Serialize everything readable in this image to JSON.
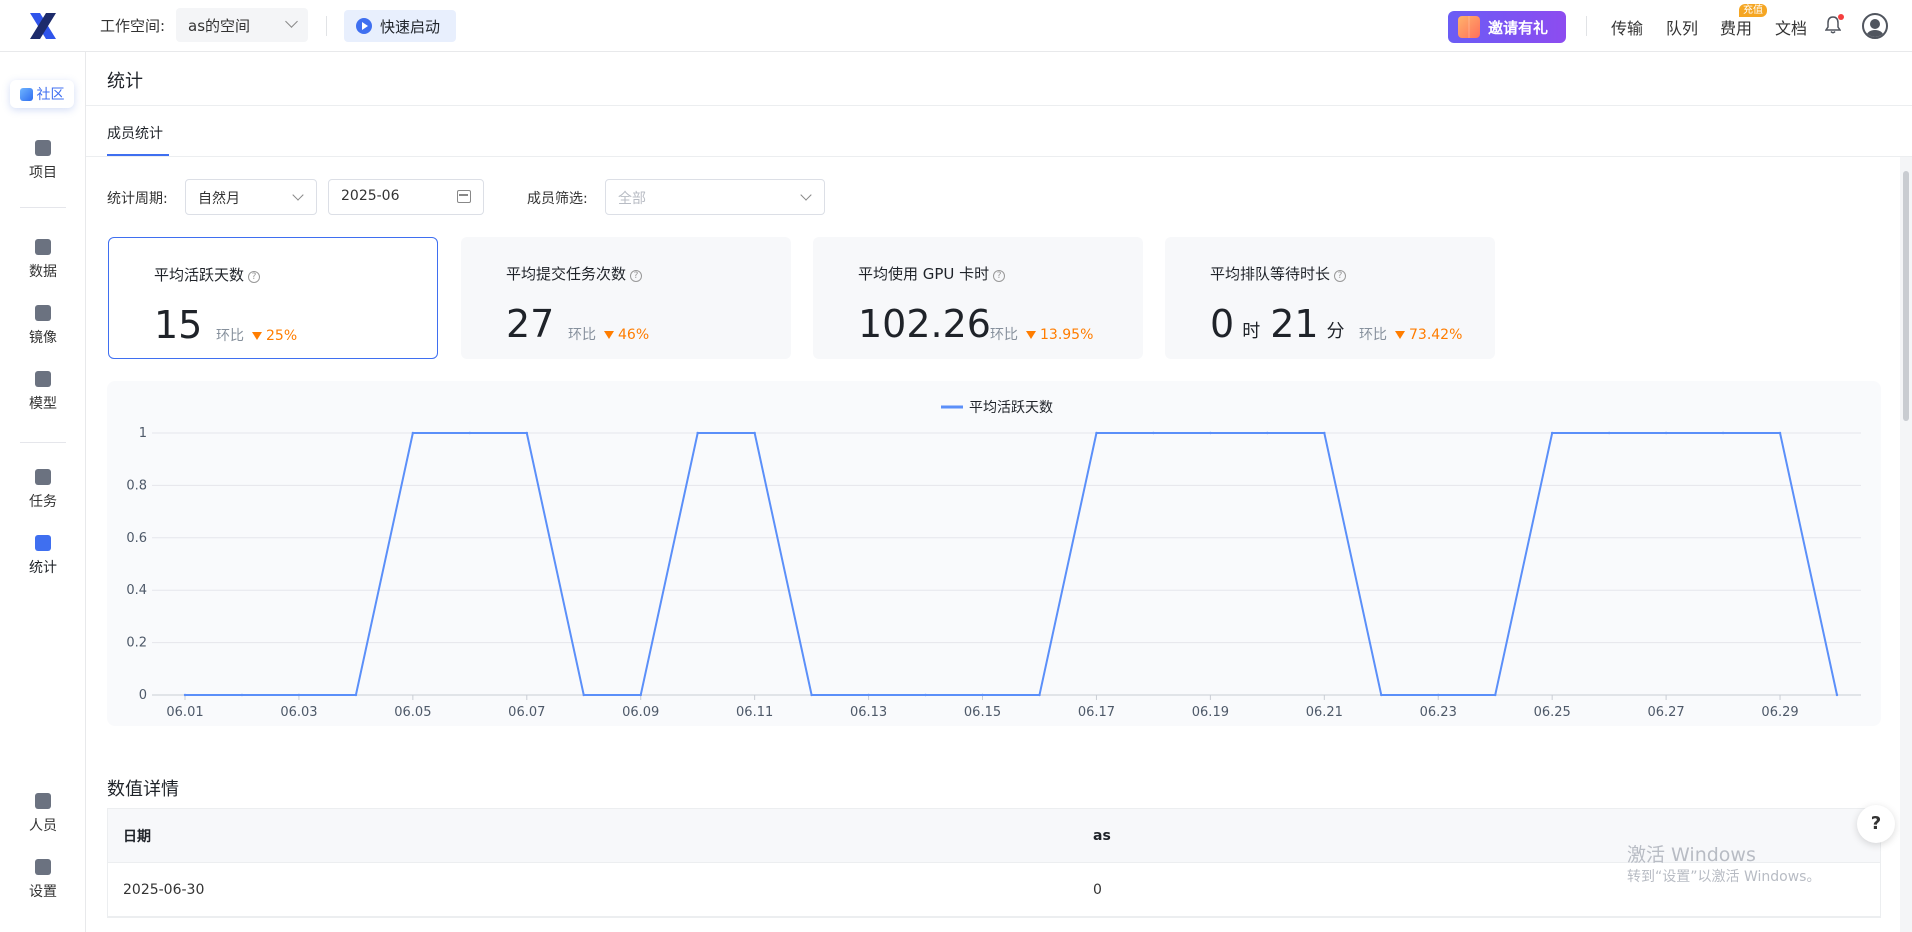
{
  "topbar": {
    "workspace_label": "工作空间:",
    "workspace_value": "as的空间",
    "quick_start": "快速启动",
    "invite": "邀请有礼",
    "nav": [
      "传输",
      "队列",
      "费用",
      "文档"
    ],
    "fee_badge": "充值"
  },
  "sidebar": {
    "community": "社区",
    "items": [
      "项目",
      "数据",
      "镜像",
      "模型",
      "任务",
      "统计",
      "人员",
      "设置"
    ]
  },
  "page": {
    "title": "统计",
    "tab": "成员统计"
  },
  "filters": {
    "period_label": "统计周期:",
    "period_value": "自然月",
    "month_value": "2025-06",
    "member_label": "成员筛选:",
    "member_placeholder": "全部"
  },
  "cards": [
    {
      "label": "平均活跃天数",
      "value": "15",
      "ring_label": "环比",
      "ring": "25%"
    },
    {
      "label": "平均提交任务次数",
      "value": "27",
      "ring_label": "环比",
      "ring": "46%"
    },
    {
      "label": "平均使用 GPU 卡时",
      "value": "102.26",
      "ring_label": "环比",
      "ring": "13.95%"
    },
    {
      "label": "平均排队等待时长",
      "hours": "0",
      "hours_unit": "时",
      "minutes": "21",
      "minutes_unit": "分",
      "ring_label": "环比",
      "ring": "73.42%"
    }
  ],
  "chart_data": {
    "type": "line",
    "series": [
      {
        "name": "平均活跃天数",
        "values": [
          0,
          0,
          0,
          0,
          1,
          1,
          1,
          0,
          0,
          1,
          1,
          0,
          0,
          0,
          0,
          0,
          1,
          1,
          1,
          1,
          1,
          0,
          0,
          0,
          1,
          1,
          1,
          1,
          1,
          0
        ]
      }
    ],
    "x": [
      "06.01",
      "06.02",
      "06.03",
      "06.04",
      "06.05",
      "06.06",
      "06.07",
      "06.08",
      "06.09",
      "06.10",
      "06.11",
      "06.12",
      "06.13",
      "06.14",
      "06.15",
      "06.16",
      "06.17",
      "06.18",
      "06.19",
      "06.20",
      "06.21",
      "06.22",
      "06.23",
      "06.24",
      "06.25",
      "06.26",
      "06.27",
      "06.28",
      "06.29",
      "06.30"
    ],
    "x_tick_labels": [
      "06.01",
      "06.03",
      "06.05",
      "06.07",
      "06.09",
      "06.11",
      "06.13",
      "06.15",
      "06.17",
      "06.19",
      "06.21",
      "06.23",
      "06.25",
      "06.27",
      "06.29"
    ],
    "y_tick_labels": [
      "0",
      "0.2",
      "0.4",
      "0.6",
      "0.8",
      "1"
    ],
    "ylim": [
      0,
      1
    ],
    "grid": true,
    "legend": "top-center",
    "color": "#5b8ff9"
  },
  "details": {
    "title": "数值详情",
    "headers": [
      "日期",
      "as"
    ],
    "rows": [
      [
        "2025-06-30",
        "0"
      ]
    ]
  },
  "watermark": {
    "line1": "激活 Windows",
    "line2": "转到“设置”以激活 Windows。"
  },
  "help": "?"
}
